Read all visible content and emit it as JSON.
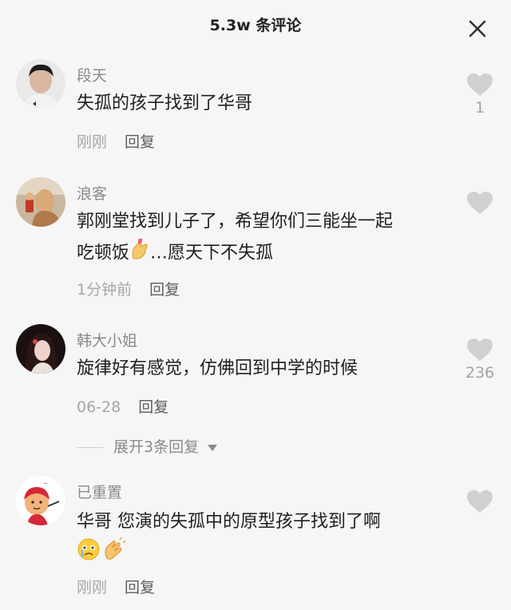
{
  "header": {
    "title": "5.3w 条评论"
  },
  "comments": [
    {
      "user": "段天",
      "text": "失孤的孩子找到了华哥",
      "time": "刚刚",
      "reply_label": "回复",
      "likes": "1"
    },
    {
      "user": "浪客",
      "text_line1": "郭刚堂找到儿子了，希望你们三能坐一起",
      "text_line2a": "吃顿饭",
      "text_line2b": "…愿天下不失孤",
      "time": "1分钟前",
      "reply_label": "回复",
      "likes": ""
    },
    {
      "user": "韩大小姐",
      "text": "旋律好有感觉，仿佛回到中学的时候",
      "time": "06-28",
      "reply_label": "回复",
      "likes": "236"
    },
    {
      "user": "已重置",
      "text": "华哥 您演的失孤中的原型孩子找到了啊",
      "time": "刚刚",
      "reply_label": "回复",
      "likes": ""
    }
  ],
  "expand_replies": {
    "label": "展开3条回复"
  },
  "icons": {
    "close": "close-icon",
    "like": "heart-icon",
    "expand": "caret-down-icon",
    "emoji1": "finger-heart-emoji",
    "emoji2": "crying-face-emoji",
    "emoji3": "clapping-hands-emoji"
  },
  "colors": {
    "background": "#f6f6f6",
    "heart": "#d0d0d0",
    "secondary_text": "#8a8a8a"
  }
}
